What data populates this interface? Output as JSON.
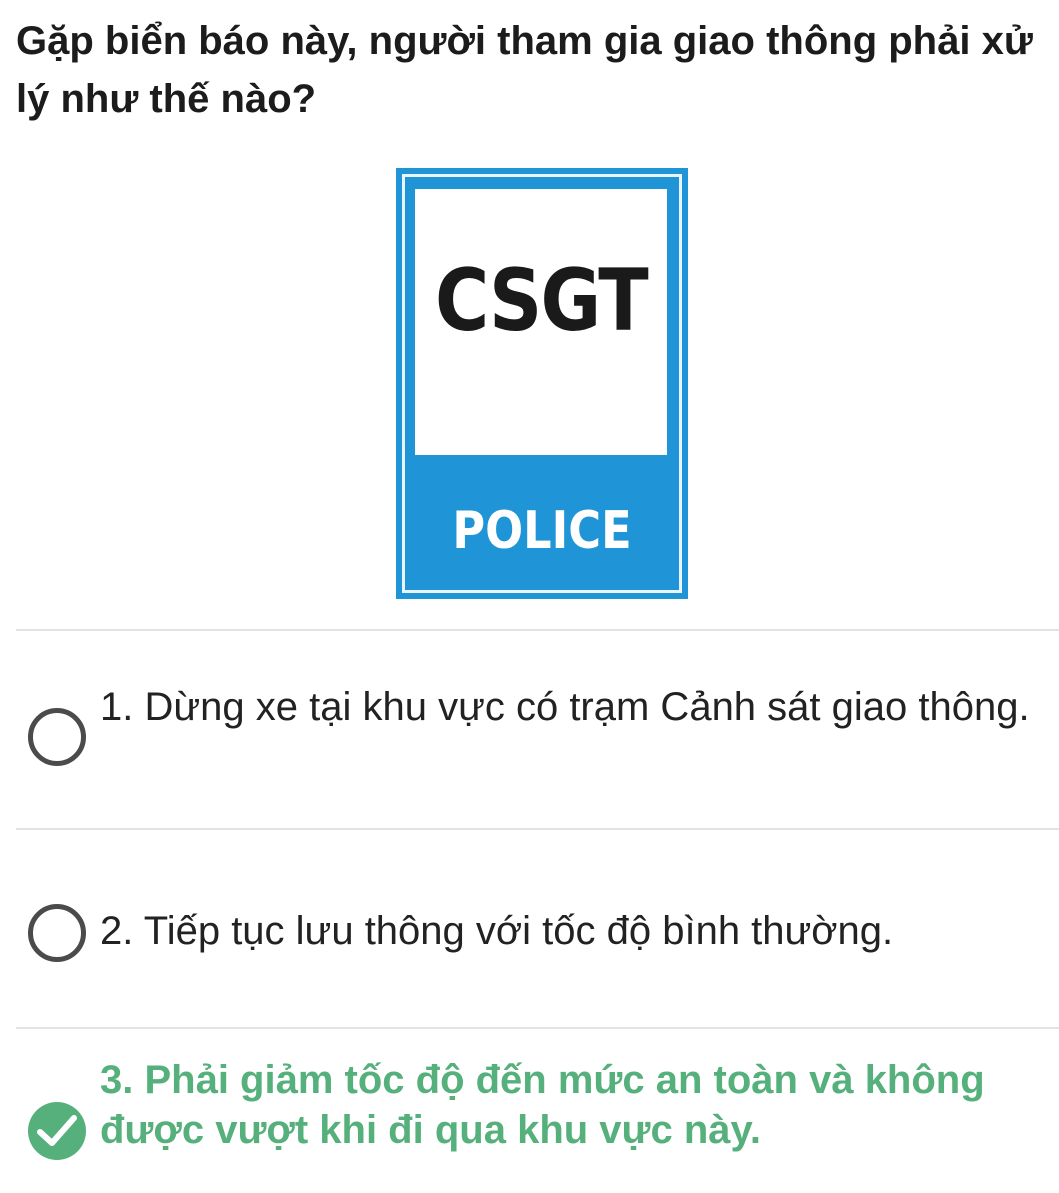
{
  "question": {
    "text": "Gặp biển báo này, người tham gia giao thông phải xử lý như thế nào?"
  },
  "sign": {
    "top_text": "CSGT",
    "bottom_text": "POLICE",
    "colors": {
      "blue": "#1f94d6",
      "panel": "#ffffff"
    }
  },
  "options": [
    {
      "label": "1. Dừng xe tại khu vực có trạm Cảnh sát giao thông.",
      "selected": false
    },
    {
      "label": "2. Tiếp tục lưu thông với tốc độ bình thường.",
      "selected": false
    },
    {
      "label": "3. Phải giảm tốc độ đến mức an toàn và không được vượt khi đi qua khu vực này.",
      "selected": true
    }
  ],
  "colors": {
    "correct": "#56b07c",
    "radio_border": "#4b4b4b",
    "divider": "#e3e3e3"
  },
  "icons": {
    "unselected": "radio-empty-icon",
    "correct": "check-circle-icon"
  }
}
